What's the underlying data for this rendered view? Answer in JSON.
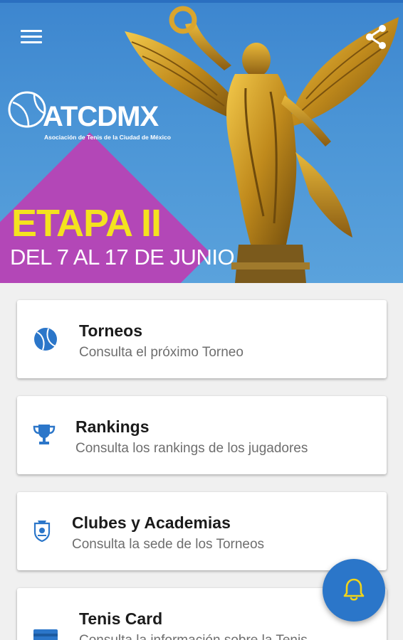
{
  "header": {
    "menu_icon": "hamburger-menu-icon",
    "share_icon": "share-icon",
    "logo_text": "ATCDMX",
    "logo_subtitle": "Asociación de Tenis de la Ciudad de México",
    "banner_title": "ETAPA II",
    "banner_dates": "DEL 7 AL 17 DE JUNIO"
  },
  "cards": [
    {
      "title": "Torneos",
      "description": "Consulta el próximo Torneo",
      "icon": "tennis-ball-icon"
    },
    {
      "title": "Rankings",
      "description": "Consulta los rankings de los jugadores",
      "icon": "trophy-icon"
    },
    {
      "title": "Clubes y Academias",
      "description": "Consulta la sede de los Torneos",
      "icon": "crest-icon"
    },
    {
      "title": "Tenis Card",
      "description": "Consulta la información sobre la Tenis",
      "icon": "card-icon"
    }
  ],
  "fab": {
    "icon": "bell-icon"
  },
  "colors": {
    "primary_blue": "#2b76c9",
    "banner_yellow": "#f4e21f",
    "banner_purple": "#b347b7",
    "bell_yellow": "#f2d418"
  }
}
